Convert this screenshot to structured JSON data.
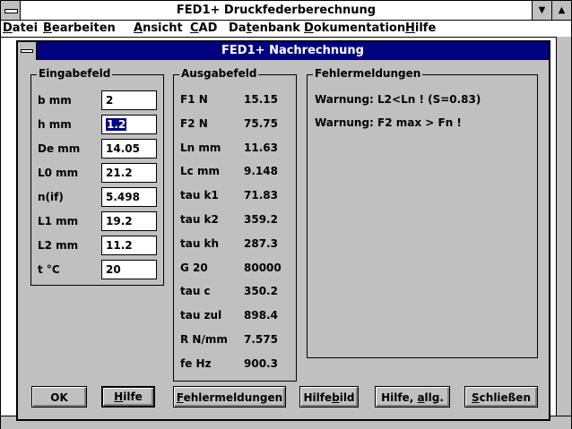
{
  "app": {
    "title": "FED1+  Druckfederberechnung",
    "minimize_glyph": "▼",
    "maximize_glyph": "▲"
  },
  "menu": [
    {
      "mnemonic": "D",
      "rest": "atei"
    },
    {
      "mnemonic": "B",
      "rest": "earbeiten"
    },
    {
      "mnemonic": "A",
      "rest": "nsicht"
    },
    {
      "mnemonic": "C",
      "rest": "AD"
    },
    {
      "pre": "Da",
      "mnemonic": "t",
      "rest": "enbank"
    },
    {
      "mnemonic": "D",
      "rest": "okumentation"
    },
    {
      "mnemonic": "H",
      "rest": "ilfe"
    }
  ],
  "dialog": {
    "title": "FED1+   Nachrechnung"
  },
  "eingabe": {
    "label": "Eingabefeld",
    "rows": [
      {
        "label": "b    mm",
        "value": "2"
      },
      {
        "label": "h    mm",
        "value": "1.2",
        "selected": true
      },
      {
        "label": "De   mm",
        "value": "14.05"
      },
      {
        "label": "L0   mm",
        "value": "21.2"
      },
      {
        "label": "n(if)",
        "value": "5.498"
      },
      {
        "label": "L1   mm",
        "value": "19.2"
      },
      {
        "label": "L2   mm",
        "value": "11.2"
      },
      {
        "label": "t    °C",
        "value": "20"
      }
    ]
  },
  "ausgabe": {
    "label": "Ausgabefeld",
    "rows": [
      {
        "label": "F1    N",
        "value": "15.15"
      },
      {
        "label": "F2    N",
        "value": "75.75"
      },
      {
        "label": "Ln   mm",
        "value": "11.63"
      },
      {
        "label": "Lc   mm",
        "value": "9.148"
      },
      {
        "label": "tau k1",
        "value": "71.83"
      },
      {
        "label": "tau k2",
        "value": "359.2"
      },
      {
        "label": "tau kh",
        "value": "287.3"
      },
      {
        "label": "G  20",
        "value": "80000"
      },
      {
        "label": "tau c",
        "value": "350.2"
      },
      {
        "label": "tau zul",
        "value": "898.4"
      },
      {
        "label": "R  N/mm",
        "value": "7.575"
      },
      {
        "label": "fe   Hz",
        "value": "900.3"
      }
    ]
  },
  "fehler": {
    "label": "Fehlermeldungen",
    "messages": [
      "Warnung: L2<Ln ! (S=0.83)",
      "Warnung: F2 max > Fn !"
    ]
  },
  "buttons": [
    {
      "name": "ok-button",
      "pre": "",
      "mnemonic": "",
      "rest": "OK",
      "default": false
    },
    {
      "name": "hilfe-button",
      "pre": "",
      "mnemonic": "H",
      "rest": "ilfe",
      "default": true
    },
    {
      "name": "fehlermeldungen-button",
      "pre": "",
      "mnemonic": "F",
      "rest": "ehlermeldungen",
      "default": false
    },
    {
      "name": "hilfebild-button",
      "pre": "Hilfe",
      "mnemonic": "b",
      "rest": "ild",
      "default": false
    },
    {
      "name": "hilfe-allg-button",
      "pre": "Hilfe, ",
      "mnemonic": "a",
      "rest": "llg.",
      "default": false
    },
    {
      "name": "schliessen-button",
      "pre": "",
      "mnemonic": "S",
      "rest": "chließen",
      "default": false
    }
  ]
}
